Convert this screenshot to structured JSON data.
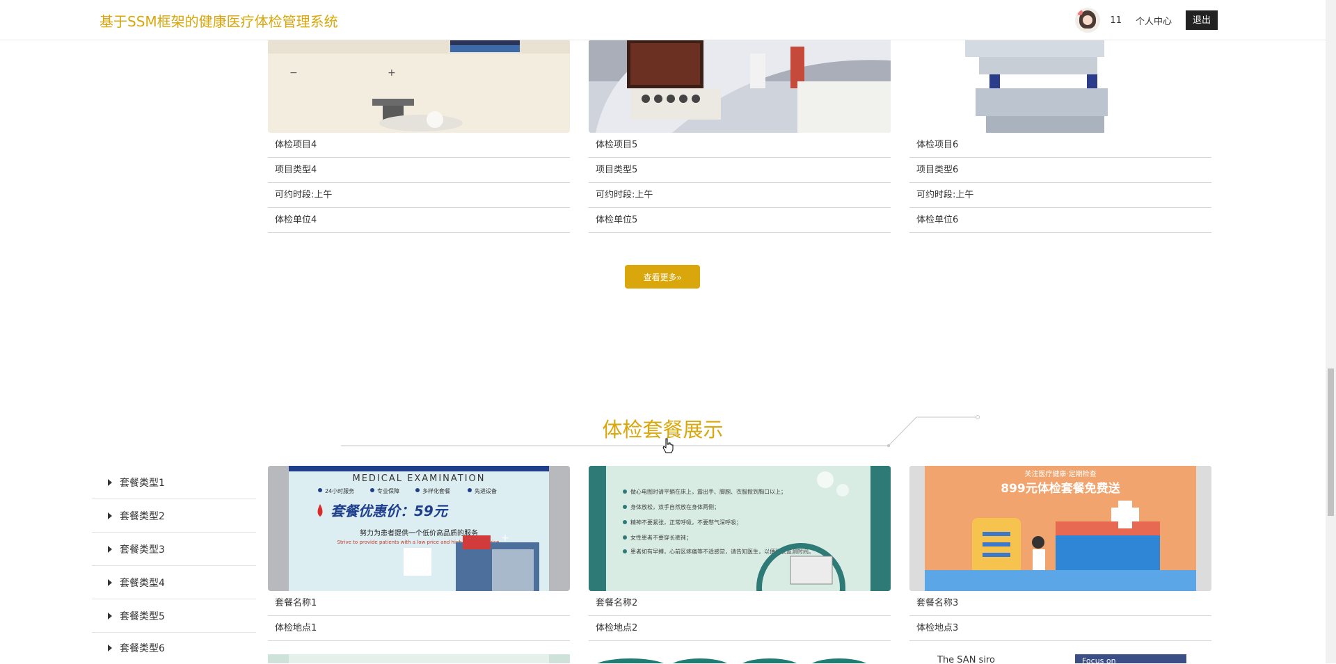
{
  "header": {
    "site_title": "基于SSM框架的健康医疗体检管理系统",
    "username": "11",
    "personal_center": "个人中心",
    "logout": "退出"
  },
  "projects": [
    {
      "name": "体检项目4",
      "type": "项目类型4",
      "time_slot": "可约时段:上午",
      "unit": "体检单位4"
    },
    {
      "name": "体检项目5",
      "type": "项目类型5",
      "time_slot": "可约时段:上午",
      "unit": "体检单位5"
    },
    {
      "name": "体检项目6",
      "type": "项目类型6",
      "time_slot": "可约时段:上午",
      "unit": "体检单位6"
    }
  ],
  "more_button": "查看更多»",
  "package_section_title": "体检套餐展示",
  "package_categories": [
    "套餐类型1",
    "套餐类型2",
    "套餐类型3",
    "套餐类型4",
    "套餐类型5",
    "套餐类型6"
  ],
  "packages": [
    {
      "name": "套餐名称1",
      "location": "体检地点1",
      "poster_lines": [
        "MEDICAL EXAMINATION",
        "24小时服务",
        "专业保障",
        "多样化套餐",
        "先进设备",
        "套餐优惠价：59元",
        "努力为患者提供一个低价高品质的服务",
        "Strive to provide patients with a low price and high quality service."
      ]
    },
    {
      "name": "套餐名称2",
      "location": "体检地点2",
      "poster_lines": [
        "做心电图时请平躺在床上，露出手、脚腕、衣服掀到胸口以上；",
        "身体放松，双手自然放在身体两侧；",
        "精神不要紧张，正常呼吸，不要憋气深呼吸；",
        "女性患者不要穿长裤袜；",
        "患者如有早搏，心前区疼痛等不适感觉，请告知医生，以便延长监测时间。"
      ]
    },
    {
      "name": "套餐名称3",
      "location": "体检地点3",
      "poster_lines": [
        "关注医疗健康·定期检查",
        "899元体检套餐免费送"
      ]
    }
  ],
  "bottom_peek": {
    "p3_text": "The SAN siro",
    "p3_text2": "Focus on"
  },
  "colors": {
    "accent": "#d9a70c",
    "logout_bg": "#222222"
  }
}
